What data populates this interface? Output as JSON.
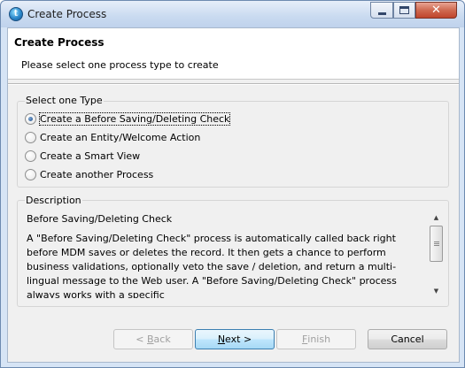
{
  "window": {
    "title": "Create Process",
    "app_icon_letter": "t",
    "controls": {
      "minimize": "minimize-icon",
      "maximize": "maximize-icon",
      "close": "✕"
    }
  },
  "header": {
    "title": "Create Process",
    "subtitle": "Please select one process type to create"
  },
  "type_group": {
    "legend": "Select one Type",
    "options": [
      {
        "label": "Create a Before Saving/Deleting Check",
        "checked": true
      },
      {
        "label": "Create an Entity/Welcome Action",
        "checked": false
      },
      {
        "label": "Create a Smart View",
        "checked": false
      },
      {
        "label": "Create another Process",
        "checked": false
      }
    ]
  },
  "description_group": {
    "legend": "Description",
    "heading": "Before Saving/Deleting Check",
    "body": "A \"Before Saving/Deleting Check\" process is automatically called back right before MDM saves or deletes the record. It then gets a chance to perform business validations, optionally veto the save / deletion, and return a multi-lingual message to the Web user. A \"Before Saving/Deleting Check\" process always works with a specific"
  },
  "buttons": {
    "back": {
      "mnemonic": "< ",
      "underline": "B",
      "rest": "ack",
      "enabled": false
    },
    "next": {
      "underline": "N",
      "rest": "ext >",
      "enabled": true
    },
    "finish": {
      "underline": "F",
      "rest": "inish",
      "enabled": false
    },
    "cancel": {
      "label": "Cancel",
      "enabled": true
    }
  }
}
